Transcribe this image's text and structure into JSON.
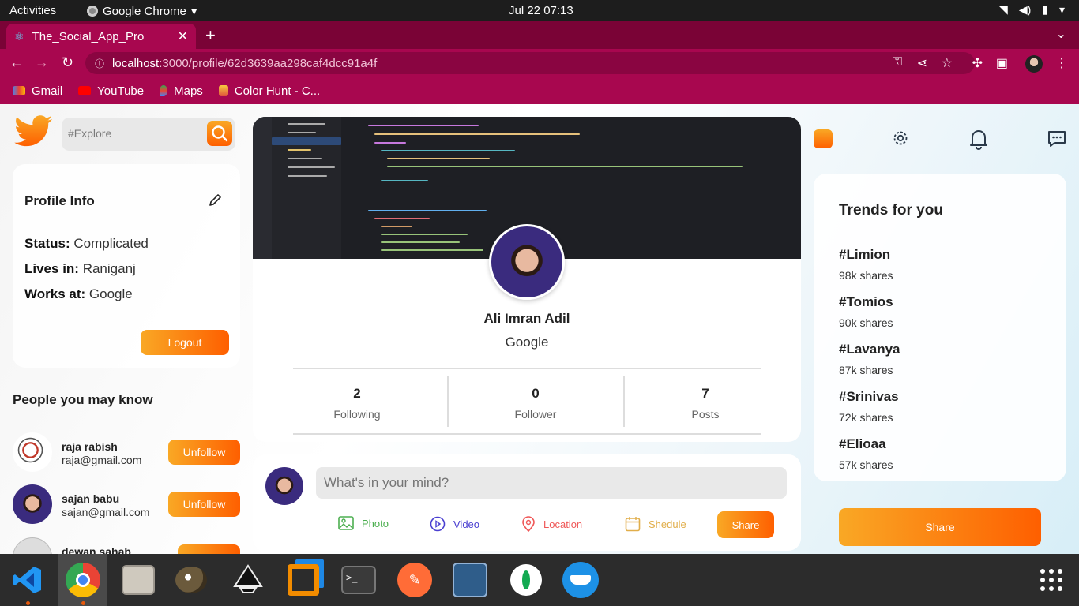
{
  "system": {
    "activities": "Activities",
    "app_name": "Google Chrome",
    "clock": "Jul 22  07:13"
  },
  "browser": {
    "tab_title": "The_Social_App_Pro",
    "url_host": "localhost",
    "url_path": ":3000/profile/62d3639aa298caf4dcc91a4f",
    "bookmarks": [
      "Gmail",
      "YouTube",
      "Maps",
      "Color Hunt - C..."
    ]
  },
  "left": {
    "search_placeholder": "#Explore",
    "profile_info_title": "Profile Info",
    "status_label": "Status:",
    "status_value": "Complicated",
    "lives_label": "Lives in:",
    "lives_value": "Raniganj",
    "works_label": "Works at:",
    "works_value": "Google",
    "logout": "Logout",
    "pymk_title": "People you may know",
    "people": [
      {
        "name": "raja rabish",
        "email": "raja@gmail.com",
        "button": "Unfollow"
      },
      {
        "name": "sajan babu",
        "email": "sajan@gmail.com",
        "button": "Unfollow"
      },
      {
        "name": "dewan sahab",
        "email": "",
        "button": ""
      }
    ]
  },
  "profile": {
    "name": "Ali Imran Adil",
    "work": "Google",
    "stats": [
      {
        "value": "2",
        "label": "Following"
      },
      {
        "value": "0",
        "label": "Follower"
      },
      {
        "value": "7",
        "label": "Posts"
      }
    ]
  },
  "share_box": {
    "placeholder": "What's in your mind?",
    "options": [
      {
        "label": "Photo",
        "color": "#4caf50"
      },
      {
        "label": "Video",
        "color": "#4a3fd1"
      },
      {
        "label": "Location",
        "color": "#ef5757"
      },
      {
        "label": "Shedule",
        "color": "#e1ae4a"
      }
    ],
    "button": "Share"
  },
  "trends": {
    "title": "Trends for you",
    "items": [
      {
        "tag": "#Limion",
        "shares": "98k shares"
      },
      {
        "tag": "#Tomios",
        "shares": "90k shares"
      },
      {
        "tag": "#Lavanya",
        "shares": "87k shares"
      },
      {
        "tag": "#Srinivas",
        "shares": "72k shares"
      },
      {
        "tag": "#Elioaa",
        "shares": "57k shares"
      }
    ],
    "share_button": "Share"
  },
  "colors": {
    "accent_start": "#f9a825",
    "accent_end": "#fe5f00",
    "chrome_frame": "#a8074f"
  }
}
